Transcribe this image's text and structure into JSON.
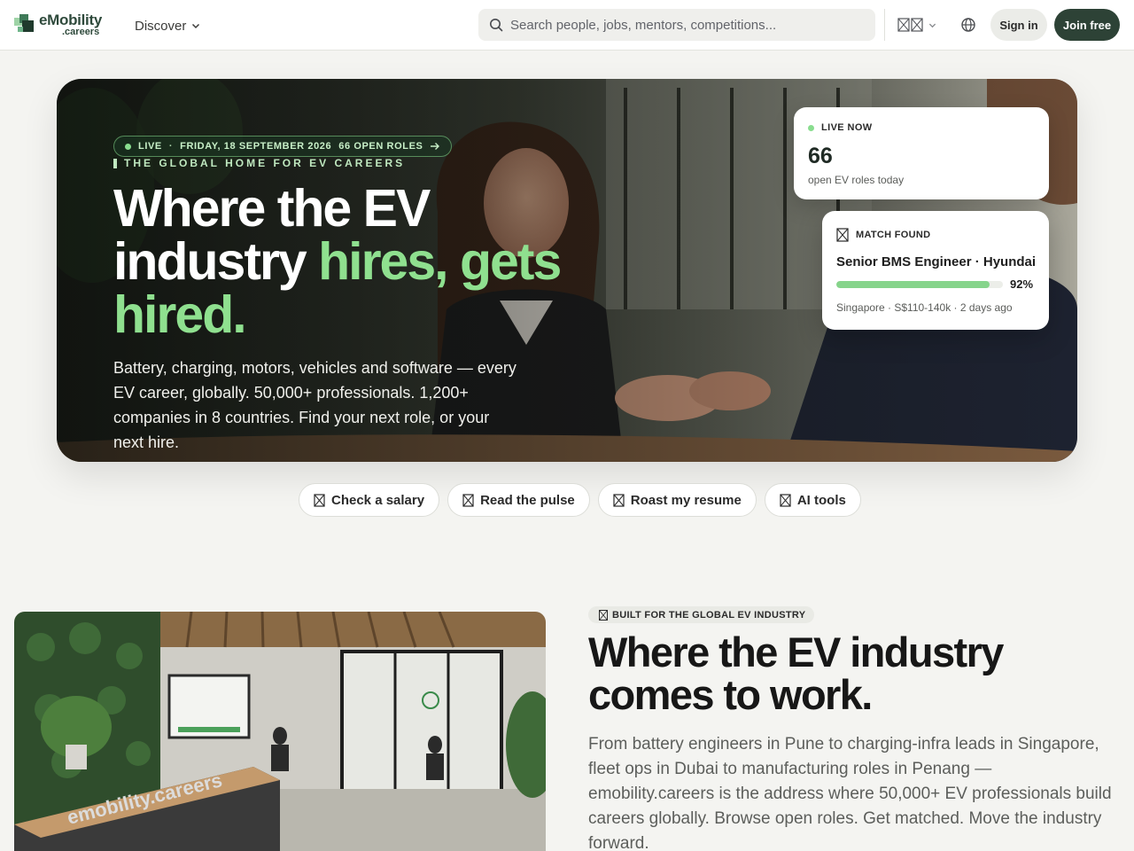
{
  "brand": {
    "name": "eMobility",
    "domain": ".careers",
    "dark_green": "#2d4236",
    "accent_green": "#8fe08f"
  },
  "nav": {
    "discover_label": "Discover",
    "search_placeholder": "Search people, jobs, mentors, competitions...",
    "language_icon": "language-icon",
    "globe_icon": "globe-icon",
    "signin_label": "Sign in",
    "join_label": "Join free"
  },
  "hero": {
    "live_label": "LIVE",
    "date": "FRIDAY, 18 SEPTEMBER 2026",
    "open_roles_pill": "66 OPEN ROLES",
    "eyebrow": "THE GLOBAL HOME FOR EV CAREERS",
    "title_line1": "Where the EV",
    "title_line2_plain": "industry ",
    "title_line2_highlight": "hires, gets",
    "title_line3_highlight": "hired.",
    "description": "Battery, charging, motors, vehicles and software — every EV career, globally. 50,000+ professionals. 1,200+ companies in 8 countries. Find your next role, or your next hire."
  },
  "live_card": {
    "label": "LIVE NOW",
    "count": "66",
    "caption": "open EV roles today"
  },
  "match_card": {
    "label": "MATCH FOUND",
    "role": "Senior BMS Engineer · Hyundai",
    "match_percent": "92%",
    "match_fraction": 0.92,
    "meta": "Singapore · S$110-140k · 2 days ago"
  },
  "chips": [
    {
      "label": "Check a salary",
      "icon": "salary-icon"
    },
    {
      "label": "Read the pulse",
      "icon": "pulse-icon"
    },
    {
      "label": "Roast my resume",
      "icon": "resume-icon"
    },
    {
      "label": "AI tools",
      "icon": "ai-tools-icon"
    }
  ],
  "about": {
    "badge": "BUILT FOR THE GLOBAL EV INDUSTRY",
    "title": "Where the EV industry comes to work.",
    "description": "From battery engineers in Pune to charging-infra leads in Singapore, fleet ops in Dubai to manufacturing roles in Penang — emobility.careers is the address where 50,000+ EV professionals build careers globally. Browse open roles. Get matched. Move the industry forward.",
    "office_sign": "emobility.careers"
  }
}
